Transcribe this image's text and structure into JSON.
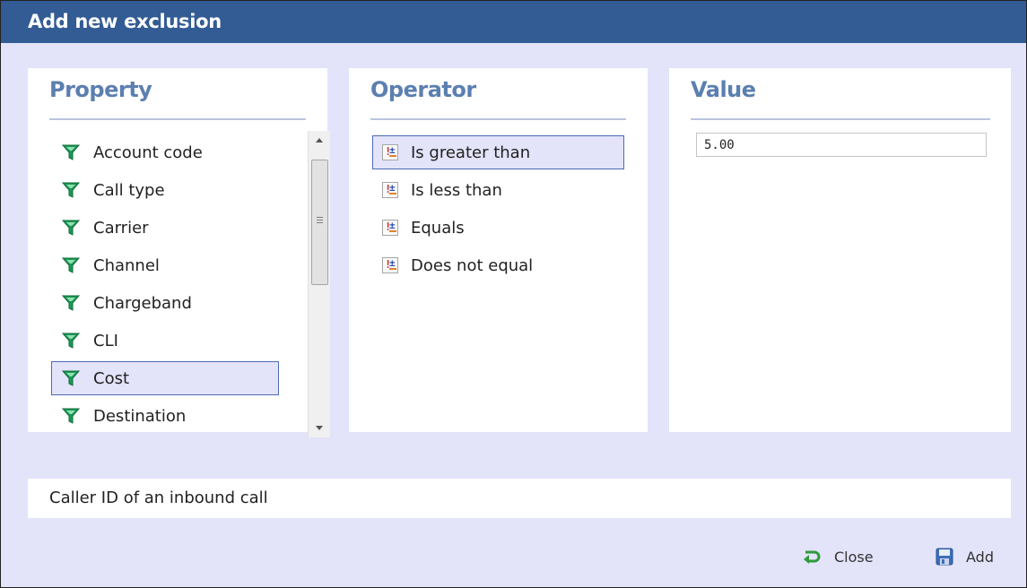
{
  "dialog": {
    "title": "Add new exclusion"
  },
  "property": {
    "heading": "Property",
    "items": [
      {
        "label": "Account code",
        "selected": false
      },
      {
        "label": "Call type",
        "selected": false
      },
      {
        "label": "Carrier",
        "selected": false
      },
      {
        "label": "Channel",
        "selected": false
      },
      {
        "label": "Chargeband",
        "selected": false
      },
      {
        "label": "CLI",
        "selected": false
      },
      {
        "label": "Cost",
        "selected": true
      },
      {
        "label": "Destination",
        "selected": false
      }
    ],
    "item_icon": "funnel-icon"
  },
  "operator": {
    "heading": "Operator",
    "items": [
      {
        "label": "Is greater than",
        "selected": true
      },
      {
        "label": "Is less than",
        "selected": false
      },
      {
        "label": "Equals",
        "selected": false
      },
      {
        "label": "Does not equal",
        "selected": false
      }
    ],
    "item_icon": "operator-icon"
  },
  "value": {
    "heading": "Value",
    "input_value": "5.00"
  },
  "description": "Caller ID of an inbound call",
  "buttons": {
    "close_label": "Close",
    "add_label": "Add"
  },
  "colors": {
    "titlebar": "#335c94",
    "background": "#e3e3fa",
    "heading": "#5b7fb0",
    "selection_border": "#4b6cb5",
    "funnel_icon": "#1a9a55"
  }
}
